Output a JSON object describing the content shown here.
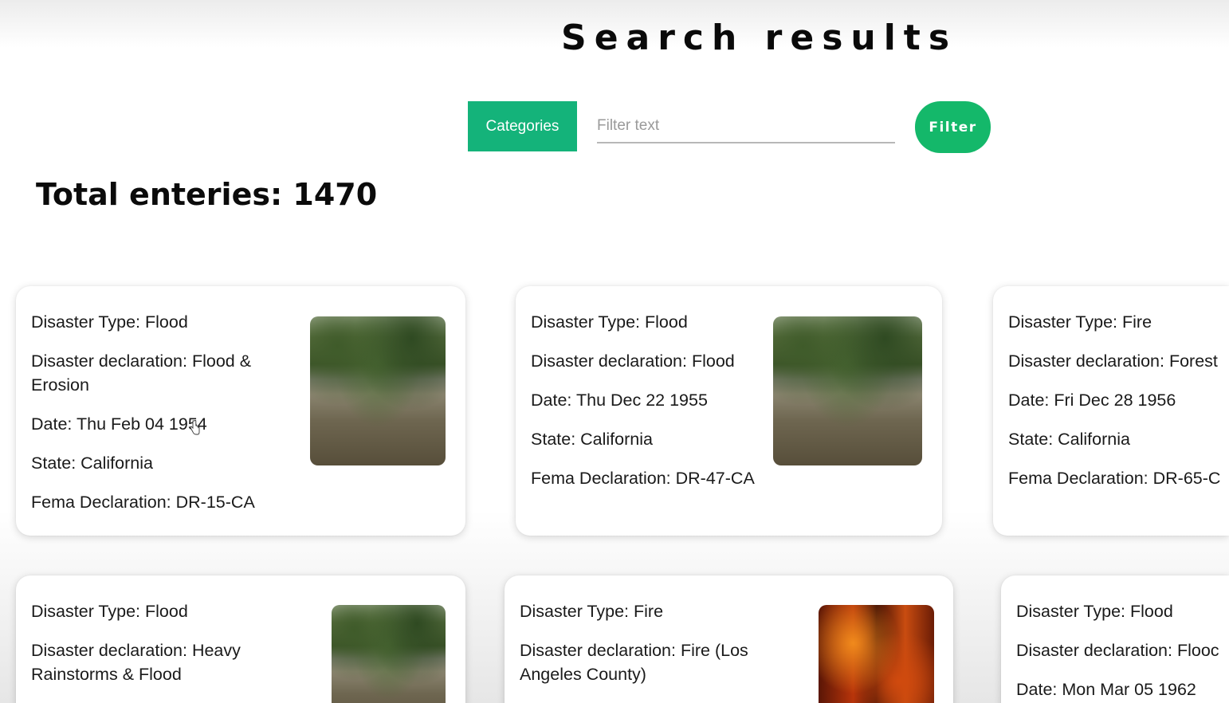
{
  "header": {
    "title": "Search results"
  },
  "search": {
    "categories_label": "Categories",
    "placeholder": "Filter text",
    "value": "",
    "filter_label": "Filter"
  },
  "summary": {
    "total_text": "Total enteries: 1470"
  },
  "cards": [
    {
      "type": "Disaster Type: Flood",
      "declaration": "Disaster declaration: Flood & Erosion",
      "date": "Date: Thu Feb 04 1954",
      "state": "State: California",
      "fema": "Fema Declaration: DR-15-CA",
      "image_icon": "flood-photo"
    },
    {
      "type": "Disaster Type: Flood",
      "declaration": "Disaster declaration: Flood",
      "date": "Date: Thu Dec 22 1955",
      "state": "State: California",
      "fema": "Fema Declaration: DR-47-CA",
      "image_icon": "flood-photo"
    },
    {
      "type": "Disaster Type: Fire",
      "declaration": "Disaster declaration: Forest",
      "date": "Date: Fri Dec 28 1956",
      "state": "State: California",
      "fema": "Fema Declaration: DR-65-C",
      "image_icon": null
    },
    {
      "type": "Disaster Type: Flood",
      "declaration": "Disaster declaration: Heavy Rainstorms & Flood",
      "image_icon": "flood-photo"
    },
    {
      "type": "Disaster Type: Fire",
      "declaration": "Disaster declaration: Fire (Los Angeles County)",
      "image_icon": "fire-photo"
    },
    {
      "type": "Disaster Type: Flood",
      "declaration": "Disaster declaration: Flooc",
      "date": "Date: Mon Mar 05 1962",
      "image_icon": null
    }
  ],
  "colors": {
    "accent_green": "#14b37a",
    "filter_green": "#14b86a",
    "title_text": "#0a0a0a"
  }
}
